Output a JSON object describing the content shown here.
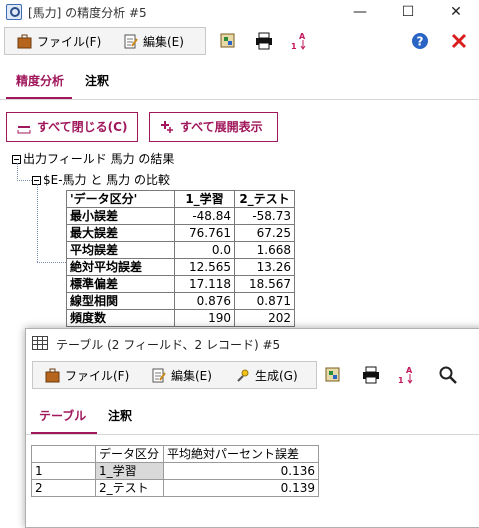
{
  "main_window": {
    "title": "[馬力] の精度分析 #5",
    "window_buttons": {
      "minimize": "—",
      "maximize": "☐",
      "close": "✕"
    },
    "menu": {
      "file": "ファイル(F)",
      "edit": "編集(E)"
    },
    "tabs": [
      {
        "label": "精度分析",
        "active": true
      },
      {
        "label": "注釈",
        "active": false
      }
    ],
    "buttons": {
      "collapse_all": "すべて閉じる(C)",
      "expand_all": "すべて展開表示"
    },
    "tree": {
      "root": "出力フィールド 馬力 の結果",
      "child": "$E-馬力 と 馬力 の比較"
    },
    "stats_table": {
      "headers": [
        "'データ区分'",
        "1_学習",
        "2_テスト"
      ],
      "rows": [
        {
          "label": "最小誤差",
          "train": "-48.84",
          "test": "-58.73"
        },
        {
          "label": "最大誤差",
          "train": "76.761",
          "test": "67.25"
        },
        {
          "label": "平均誤差",
          "train": "0.0",
          "test": "1.668"
        },
        {
          "label": "絶対平均誤差",
          "train": "12.565",
          "test": "13.26"
        },
        {
          "label": "標準偏差",
          "train": "17.118",
          "test": "18.567"
        },
        {
          "label": "線型相関",
          "train": "0.876",
          "test": "0.871"
        },
        {
          "label": "頻度数",
          "train": "190",
          "test": "202"
        }
      ]
    }
  },
  "table_window": {
    "title": "テーブル (2 フィールド、2 レコード) #5",
    "menu": {
      "file": "ファイル(F)",
      "edit": "編集(E)",
      "generate": "生成(G)"
    },
    "tabs": [
      {
        "label": "テーブル",
        "active": true
      },
      {
        "label": "注釈",
        "active": false
      }
    ],
    "columns": [
      "",
      "データ区分",
      "平均絶対パーセント誤差"
    ],
    "rows": [
      {
        "index": "1",
        "partition": "1_学習",
        "value": "0.136"
      },
      {
        "index": "2",
        "partition": "2_テスト",
        "value": "0.139"
      }
    ]
  },
  "colors": {
    "accent": "#a0175b",
    "help_blue": "#2a64c4",
    "close_red": "#d81e1e"
  }
}
